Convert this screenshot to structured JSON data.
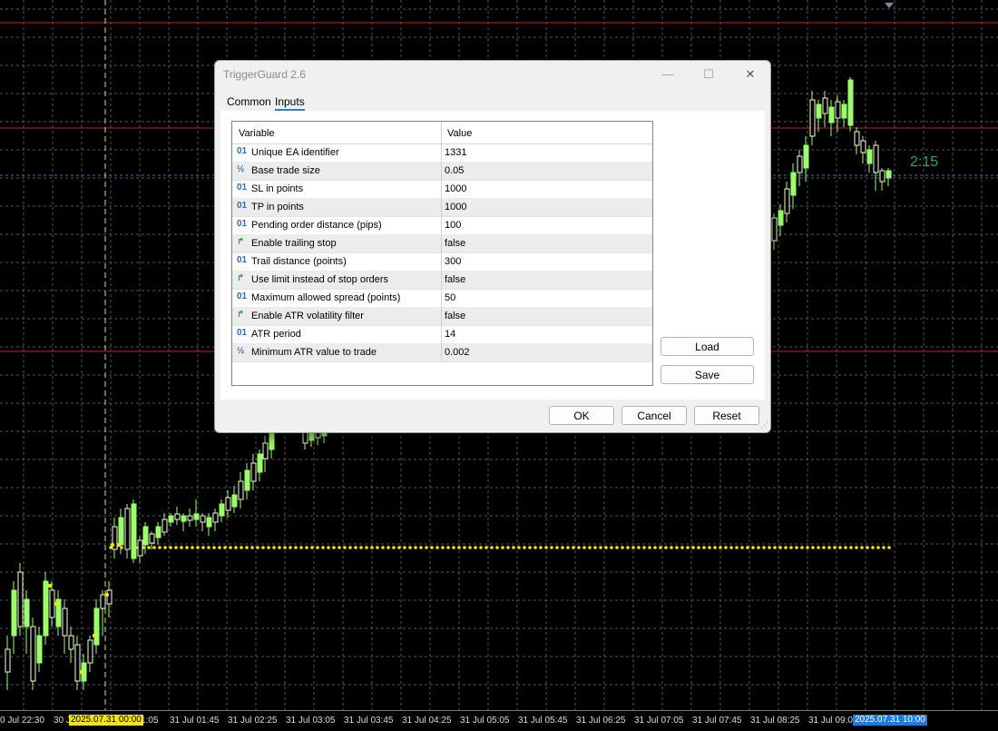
{
  "chart": {
    "time_labels": [
      "0 Jul 22:30",
      "30 J",
      "1:05",
      "31 Jul 01:45",
      "31 Jul 02:25",
      "31 Jul 03:05",
      "31 Jul 03:45",
      "31 Jul 04:25",
      "31 Jul 05:05",
      "31 Jul 05:45",
      "31 Jul 06:25",
      "31 Jul 07:05",
      "31 Jul 07:45",
      "31 Jul 08:25",
      "31 Jul 09:05"
    ],
    "highlight_left": "2025.07.31 00:00",
    "highlight_right": "2025.07.31 10:00",
    "countdown": "2:15",
    "colors": {
      "bull": "#f5ffd9",
      "bear": "#9aff6a",
      "grid": "#555555",
      "level": "#c62020",
      "dots": "#f3e600",
      "vline": "#d6e84c",
      "hl_left_bg": "#f3e600",
      "hl_right_bg": "#1e7be0"
    }
  },
  "dialog": {
    "title": "TriggerGuard 2.6",
    "controls": {
      "minimize": "—",
      "maximize": "☐",
      "close": "✕"
    },
    "tabs": [
      {
        "label": "Common"
      },
      {
        "label": "Inputs"
      }
    ],
    "grid": {
      "headers": {
        "variable": "Variable",
        "value": "Value"
      },
      "rows": [
        {
          "type": "int",
          "icon": "01",
          "name": "Unique EA identifier",
          "value": "1331"
        },
        {
          "type": "double",
          "icon": "½",
          "name": "Base trade size",
          "value": "0.05"
        },
        {
          "type": "int",
          "icon": "01",
          "name": "SL in points",
          "value": "1000"
        },
        {
          "type": "int",
          "icon": "01",
          "name": "TP in points",
          "value": "1000"
        },
        {
          "type": "int",
          "icon": "01",
          "name": "Pending order distance (pips)",
          "value": "100"
        },
        {
          "type": "bool",
          "icon": "↱",
          "name": "Enable trailing stop",
          "value": "false"
        },
        {
          "type": "int",
          "icon": "01",
          "name": "Trail distance (points)",
          "value": "300"
        },
        {
          "type": "bool",
          "icon": "↱",
          "name": "Use limit instead of stop orders",
          "value": "false"
        },
        {
          "type": "int",
          "icon": "01",
          "name": "Maximum allowed spread (points)",
          "value": "50"
        },
        {
          "type": "bool",
          "icon": "↱",
          "name": "Enable ATR volatility filter",
          "value": "false"
        },
        {
          "type": "int",
          "icon": "01",
          "name": "ATR period",
          "value": "14"
        },
        {
          "type": "double",
          "icon": "½",
          "name": "Minimum ATR value to trade",
          "value": "0.002"
        }
      ]
    },
    "buttons": {
      "load": "Load",
      "save": "Save",
      "ok": "OK",
      "cancel": "Cancel",
      "reset": "Reset"
    }
  }
}
